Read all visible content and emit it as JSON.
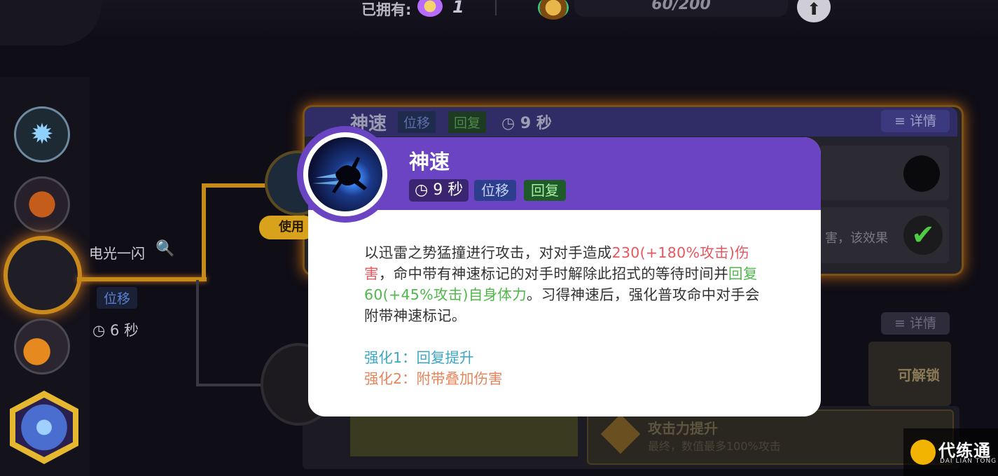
{
  "topbar": {
    "owned_label": "已拥有:",
    "owned_count": "1",
    "progress_text": "60/200",
    "home_icon": "arrow-up-icon"
  },
  "sidebar": {
    "items": [
      "gear-icon",
      "fire-skill-icon",
      "quick-attack-icon",
      "star-skill-icon",
      "hex-orb-icon"
    ]
  },
  "move_tree": {
    "name": "电光一闪",
    "tag": "位移",
    "cooldown": "6 秒",
    "use_label": "使用"
  },
  "background_panel": {
    "title": "神速",
    "tags": [
      "位移",
      "回复"
    ],
    "cooldown": "9 秒",
    "detail_label": "≡ 详情",
    "effect_text": "害，该效果",
    "unlock_label": "可解锁",
    "card_title": "攻击力提升",
    "card_desc": "最终，数值最多100%攻击"
  },
  "popup": {
    "title": "神速",
    "cooldown": "9 秒",
    "tag_move": "位移",
    "tag_heal": "回复",
    "desc_1": "以迅雷之势猛撞进行攻击，对对手造成",
    "desc_red": "230(+180%攻击)伤害",
    "desc_2": "，命中带有神速标记的对手时解除此招式的等待时间并",
    "desc_green": "回复60(+45%攻击)自身体力",
    "desc_3": "。习得神速后，强化普攻命中对手会附带神速标记。",
    "enh1": "强化1：回复提升",
    "enh2": "强化2：附带叠加伤害"
  },
  "watermark": {
    "name": "代练通",
    "sub": "DAI LIAN TONG"
  },
  "colors": {
    "popup_header": "#6b44c4",
    "damage_red": "#e8575f",
    "heal_green": "#4fb84a",
    "enh1_blue": "#3aa6c8",
    "enh2_orange": "#e8845a",
    "glow_orange": "#c98a1c"
  }
}
